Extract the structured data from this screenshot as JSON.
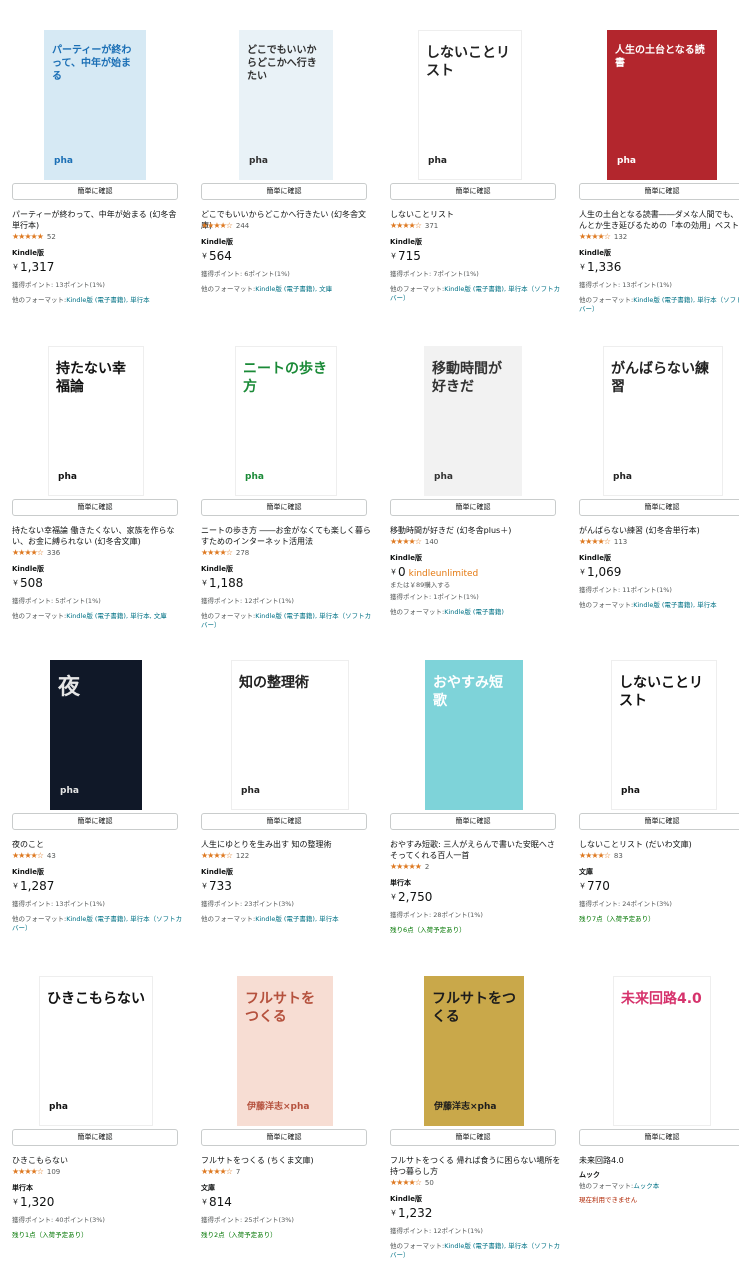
{
  "quick_view_label": "簡単に確認",
  "products": [
    {
      "title": "パーティーが終わって、中年が始まる (幻冬舎単行本)",
      "stars": "★★★★★",
      "reviews": "52",
      "format": "Kindle版",
      "price": "1,317",
      "points": "獲得ポイント: 13ポイント(1%)",
      "other_label": "他のフォーマット:",
      "other_formats": "Kindle版 (電子書籍), 単行本",
      "cover_text": "パーティーが終わって、中年が始まる",
      "cover_author": "pha"
    },
    {
      "title": "どこでもいいからどこかへ行きたい (幻冬舎文庫)",
      "stars": "★★★★☆",
      "reviews": "244",
      "format": "Kindle版",
      "price": "564",
      "points": "獲得ポイント: 6ポイント(1%)",
      "other_label": "他のフォーマット:",
      "other_formats": "Kindle版 (電子書籍), 文庫",
      "cover_text": "どこでもいいからどこかへ行きたい",
      "cover_author": "pha"
    },
    {
      "title": "しないことリスト",
      "stars": "★★★★☆",
      "reviews": "371",
      "format": "Kindle版",
      "price": "715",
      "points": "獲得ポイント: 7ポイント(1%)",
      "other_label": "他のフォーマット:",
      "other_formats": "Kindle版 (電子書籍), 単行本（ソフトカバー）",
      "cover_text": "しないことリスト",
      "cover_author": "pha"
    },
    {
      "title": "人生の土台となる読書――ダメな人間でも、なんとか生き延びるための「本の効用」ベスト30",
      "stars": "★★★★☆",
      "reviews": "132",
      "format": "Kindle版",
      "price": "1,336",
      "points": "獲得ポイント: 13ポイント(1%)",
      "other_label": "他のフォーマット:",
      "other_formats": "Kindle版 (電子書籍), 単行本（ソフトカバー）",
      "cover_text": "人生の土台となる読書",
      "cover_author": "pha"
    },
    {
      "title": "持たない幸福論 働きたくない、家族を作らない、お金に縛られない (幻冬舎文庫)",
      "stars": "★★★★☆",
      "reviews": "336",
      "format": "Kindle版",
      "price": "508",
      "points": "獲得ポイント: 5ポイント(1%)",
      "other_label": "他のフォーマット:",
      "other_formats": "Kindle版 (電子書籍), 単行本, 文庫",
      "cover_text": "持たない幸福論",
      "cover_author": "pha"
    },
    {
      "title": "ニートの歩き方 ――お金がなくても楽しく暮らすためのインターネット活用法",
      "stars": "★★★★☆",
      "reviews": "278",
      "format": "Kindle版",
      "price": "1,188",
      "points": "獲得ポイント: 12ポイント(1%)",
      "other_label": "他のフォーマット:",
      "other_formats": "Kindle版 (電子書籍), 単行本（ソフトカバー）",
      "cover_text": "ニートの歩き方",
      "cover_author": "pha"
    },
    {
      "title": "移動時間が好きだ (幻冬舎plus＋)",
      "stars": "★★★★☆",
      "reviews": "140",
      "format": "Kindle版",
      "price": "0",
      "ku_label": "kindleunlimited",
      "buy_text": "または￥89購入する",
      "points": "獲得ポイント: 1ポイント(1%)",
      "other_label": "他のフォーマット:",
      "other_formats": "Kindle版 (電子書籍)",
      "cover_text": "移動時間が好きだ",
      "cover_author": "pha"
    },
    {
      "title": "がんばらない練習 (幻冬舎単行本)",
      "stars": "★★★★☆",
      "reviews": "113",
      "format": "Kindle版",
      "price": "1,069",
      "points": "獲得ポイント: 11ポイント(1%)",
      "other_label": "他のフォーマット:",
      "other_formats": "Kindle版 (電子書籍), 単行本",
      "cover_text": "がんばらない練習",
      "cover_author": "pha"
    },
    {
      "title": "夜のこと",
      "stars": "★★★★☆",
      "reviews": "43",
      "format": "Kindle版",
      "price": "1,287",
      "points": "獲得ポイント: 13ポイント(1%)",
      "other_label": "他のフォーマット:",
      "other_formats": "Kindle版 (電子書籍), 単行本（ソフトカバー）",
      "cover_text": "夜",
      "cover_author": "pha"
    },
    {
      "title": "人生にゆとりを生み出す 知の整理術",
      "stars": "★★★★☆",
      "reviews": "122",
      "format": "Kindle版",
      "price": "733",
      "points": "獲得ポイント: 23ポイント(3%)",
      "other_label": "他のフォーマット:",
      "other_formats": "Kindle版 (電子書籍), 単行本",
      "cover_text": "知の整理術",
      "cover_author": "pha"
    },
    {
      "title": "おやすみ短歌: 三人がえらんで書いた安眠へさそってくれる百人一首",
      "stars": "★★★★★",
      "reviews": "2",
      "format": "単行本",
      "price": "2,750",
      "points": "獲得ポイント: 28ポイント(1%)",
      "stock": "残り6点（入荷予定あり）",
      "cover_text": "おやすみ短歌"
    },
    {
      "title": "しないことリスト (だいわ文庫)",
      "stars": "★★★★☆",
      "reviews": "83",
      "format": "文庫",
      "price": "770",
      "points": "獲得ポイント: 24ポイント(3%)",
      "stock": "残り7点（入荷予定あり）",
      "cover_text": "しないことリスト",
      "cover_author": "pha"
    },
    {
      "title": "ひきこもらない",
      "stars": "★★★★☆",
      "reviews": "109",
      "format": "単行本",
      "price": "1,320",
      "points": "獲得ポイント: 40ポイント(3%)",
      "stock": "残り1点（入荷予定あり）",
      "cover_text": "ひきこもらない",
      "cover_author": "pha"
    },
    {
      "title": "フルサトをつくる (ちくま文庫)",
      "stars": "★★★★☆",
      "reviews": "7",
      "format": "文庫",
      "price": "814",
      "points": "獲得ポイント: 25ポイント(3%)",
      "stock": "残り2点（入荷予定あり）",
      "cover_text": "フルサトをつくる",
      "cover_author": "伊藤洋志×pha"
    },
    {
      "title": "フルサトをつくる 帰れば食うに困らない場所を持つ暮らし方",
      "stars": "★★★★☆",
      "reviews": "50",
      "format": "Kindle版",
      "price": "1,232",
      "points": "獲得ポイント: 12ポイント(1%)",
      "other_label": "他のフォーマット:",
      "other_formats": "Kindle版 (電子書籍), 単行本（ソフトカバー）",
      "cover_text": "フルサトをつくる",
      "cover_author": "伊藤洋志×pha"
    },
    {
      "title": "未来回路4.0",
      "format": "ムック",
      "other_label": "他のフォーマット:",
      "other_formats": "ムック本",
      "unavailable": "現在利用できません",
      "cover_text": "未来回路4.0"
    }
  ]
}
